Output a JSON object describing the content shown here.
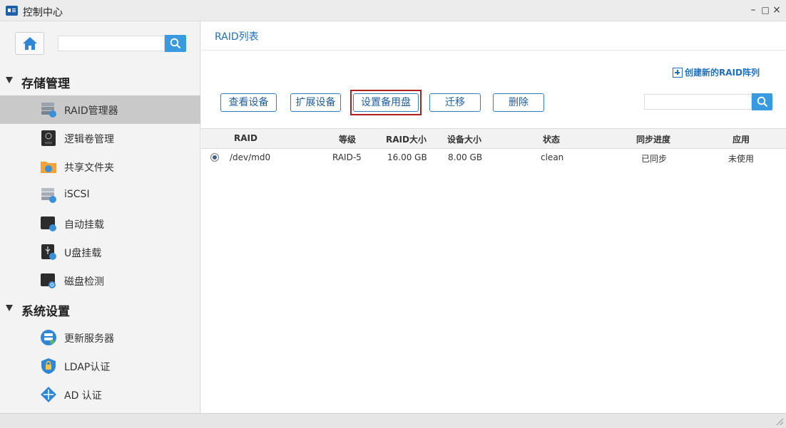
{
  "window": {
    "title": "控制中心",
    "min_label": "–",
    "max_label": "□",
    "close_label": "×"
  },
  "sidebar": {
    "search_placeholder": "",
    "groups": [
      {
        "label": "存储管理",
        "items": [
          {
            "label": "RAID管理器",
            "icon": "raid-icon",
            "active": true
          },
          {
            "label": "逻辑卷管理",
            "icon": "lvm-icon"
          },
          {
            "label": "共享文件夹",
            "icon": "shared-folder-icon"
          },
          {
            "label": "iSCSI",
            "icon": "iscsi-icon"
          },
          {
            "label": "自动挂载",
            "icon": "auto-mount-icon"
          },
          {
            "label": "U盘挂载",
            "icon": "usb-mount-icon"
          },
          {
            "label": "磁盘检测",
            "icon": "disk-check-icon"
          }
        ]
      },
      {
        "label": "系统设置",
        "items": [
          {
            "label": "更新服务器",
            "icon": "update-server-icon"
          },
          {
            "label": "LDAP认证",
            "icon": "ldap-icon"
          },
          {
            "label": "AD 认证",
            "icon": "ad-icon"
          }
        ]
      }
    ]
  },
  "main": {
    "breadcrumb": "RAID列表",
    "create_label": "创建新的RAID阵列",
    "buttons": {
      "view": "查看设备",
      "expand": "扩展设备",
      "spare": "设置备用盘",
      "migrate": "迁移",
      "delete": "删除"
    },
    "search_placeholder": "",
    "table": {
      "headers": [
        "RAID",
        "等级",
        "RAID大小",
        "设备大小",
        "状态",
        "同步进度",
        "应用"
      ],
      "rows": [
        {
          "selected": true,
          "cells": [
            "/dev/md0",
            "RAID-5",
            "16.00 GB",
            "8.00 GB",
            "clean",
            "已同步",
            "未使用"
          ]
        }
      ]
    }
  },
  "colors": {
    "accent": "#1f6fbf",
    "search_button": "#3a9ae0",
    "active_item": "#c9c9c9",
    "highlight_box": "#b21e1e"
  }
}
